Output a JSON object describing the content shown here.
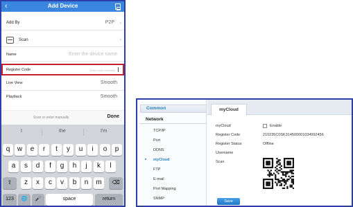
{
  "phone": {
    "header": {
      "title": "Add Device",
      "back_icon": "chevron-left-icon",
      "save_icon": "save-icon"
    },
    "add_by": {
      "label": "Add By",
      "value": "P2P",
      "chevron": "›"
    },
    "scan": {
      "label": "Scan",
      "chevron": "›"
    },
    "name": {
      "label": "Name",
      "placeholder": "Enter the device name"
    },
    "register_code": {
      "label": "Register Code",
      "placeholder": "Enter code manually"
    },
    "live_view": {
      "label": "Live View",
      "value": "Smooth"
    },
    "playback": {
      "label": "Playback",
      "value": "Smooth"
    },
    "keyboard_bar": {
      "hint": "Scan or enter manually",
      "done": "Done"
    },
    "suggestions": [
      "I",
      "the",
      "I'm"
    ],
    "keyboard": {
      "row1": [
        "q",
        "w",
        "e",
        "r",
        "t",
        "y",
        "u",
        "i",
        "o",
        "p"
      ],
      "row2": [
        "a",
        "s",
        "d",
        "f",
        "g",
        "h",
        "j",
        "k",
        "l"
      ],
      "row3": [
        "z",
        "x",
        "c",
        "v",
        "b",
        "n",
        "m"
      ],
      "numbers": "123",
      "space": "space",
      "return": "return",
      "shift": "⇧",
      "delete": "⌫",
      "globe": "🌐",
      "mic": "🎤"
    },
    "colors": {
      "header": "#3a86de",
      "highlight": "#c42030"
    }
  },
  "web": {
    "common": "Common",
    "network": "Network",
    "menu": [
      "TCP/IP",
      "Port",
      "DDNS",
      "myCloud",
      "FTP",
      "E-mail",
      "Port Mapping",
      "SNMP"
    ],
    "active_menu": "myCloud",
    "tab": "myCloud",
    "fields": {
      "mycloud_label": "myCloud",
      "enable_label": "Enable",
      "register_code_label": "Register Code",
      "register_code_value": "210235C0SK31450000103499245​6",
      "register_status_label": "Register Status",
      "register_status_value": "Offline",
      "username_label": "Username",
      "scan_label": "Scan"
    },
    "save": "Save",
    "colors": {
      "accent": "#1e7fbe",
      "button": "#1f78c8"
    }
  }
}
